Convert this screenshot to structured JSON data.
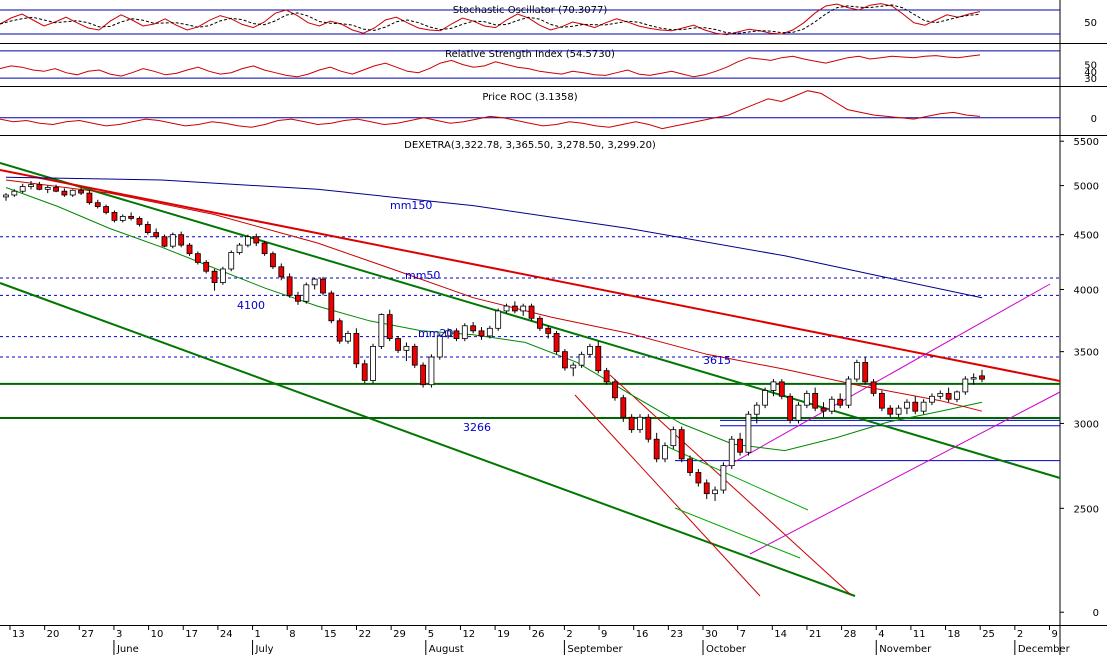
{
  "chart_data": {
    "type": "candlestick",
    "title": "DEXETRA(3,322.78, 3,365.50, 3,278.50, 3,299.20)",
    "price_axis": {
      "ticks": [
        5500,
        5000,
        4500,
        4000,
        3500,
        3000,
        2500,
        2000
      ],
      "tick_labels": [
        "5500",
        "5000",
        "4500",
        "4000",
        "3500",
        "3000",
        "2500",
        "0"
      ],
      "scale": "log",
      "range": [
        1950,
        5550
      ]
    },
    "x_axis": {
      "day_labels": [
        "13",
        "20",
        "27",
        "3",
        "10",
        "17",
        "24",
        "1",
        "8",
        "15",
        "22",
        "29",
        "5",
        "12",
        "19",
        "26",
        "2",
        "9",
        "16",
        "23",
        "30",
        "7",
        "14",
        "21",
        "28",
        "4",
        "11",
        "18",
        "25",
        "2",
        "9"
      ],
      "month_labels": [
        "June",
        "July",
        "August",
        "September",
        "October",
        "November",
        "December"
      ]
    },
    "annotations": [
      {
        "text": "mm150",
        "color": "#0000aa"
      },
      {
        "text": "mm50",
        "color": "#0000aa"
      },
      {
        "text": "mm20",
        "color": "#0000aa"
      },
      {
        "text": "4100",
        "color": "#0000aa"
      },
      {
        "text": "3615",
        "color": "#0000aa"
      },
      {
        "text": "3266",
        "color": "#0000aa"
      }
    ],
    "horizontal_levels": [
      {
        "value": 4480,
        "style": "dashed",
        "color": "#0000cc"
      },
      {
        "value": 4100,
        "style": "dashed",
        "color": "#0000cc"
      },
      {
        "value": 3950,
        "style": "dashed",
        "color": "#0000cc"
      },
      {
        "value": 3615,
        "style": "dashed",
        "color": "#0000cc"
      },
      {
        "value": 3460,
        "style": "dashed",
        "color": "#0000cc"
      },
      {
        "value": 3266,
        "style": "solid",
        "color": "#006600"
      },
      {
        "value": 3020,
        "style": "solid",
        "color": "#0000cc"
      },
      {
        "value": 2985,
        "style": "solid",
        "color": "#0000cc"
      },
      {
        "value": 2770,
        "style": "solid",
        "color": "#0000cc"
      }
    ],
    "candles": [
      [
        4880,
        4920,
        4840,
        4900
      ],
      [
        4900,
        4960,
        4880,
        4940
      ],
      [
        4940,
        5020,
        4920,
        4990
      ],
      [
        4990,
        5050,
        4960,
        5010
      ],
      [
        5010,
        5040,
        4950,
        4960
      ],
      [
        4960,
        5000,
        4920,
        4980
      ],
      [
        4980,
        5010,
        4930,
        4940
      ],
      [
        4940,
        4970,
        4880,
        4900
      ],
      [
        4900,
        4960,
        4880,
        4950
      ],
      [
        4950,
        4980,
        4900,
        4920
      ],
      [
        4920,
        4950,
        4800,
        4820
      ],
      [
        4820,
        4850,
        4760,
        4780
      ],
      [
        4780,
        4800,
        4700,
        4720
      ],
      [
        4720,
        4740,
        4620,
        4640
      ],
      [
        4640,
        4700,
        4620,
        4680
      ],
      [
        4680,
        4720,
        4640,
        4660
      ],
      [
        4660,
        4680,
        4580,
        4600
      ],
      [
        4600,
        4630,
        4500,
        4520
      ],
      [
        4520,
        4560,
        4460,
        4480
      ],
      [
        4480,
        4500,
        4380,
        4390
      ],
      [
        4390,
        4520,
        4370,
        4500
      ],
      [
        4500,
        4530,
        4380,
        4400
      ],
      [
        4400,
        4420,
        4300,
        4320
      ],
      [
        4320,
        4340,
        4220,
        4240
      ],
      [
        4240,
        4260,
        4140,
        4160
      ],
      [
        4160,
        4180,
        3990,
        4060
      ],
      [
        4060,
        4200,
        4040,
        4180
      ],
      [
        4180,
        4350,
        4160,
        4330
      ],
      [
        4330,
        4420,
        4310,
        4400
      ],
      [
        4400,
        4500,
        4380,
        4480
      ],
      [
        4480,
        4510,
        4390,
        4420
      ],
      [
        4420,
        4440,
        4300,
        4320
      ],
      [
        4320,
        4340,
        4180,
        4200
      ],
      [
        4200,
        4230,
        4080,
        4110
      ],
      [
        4110,
        4140,
        3930,
        3950
      ],
      [
        3950,
        3980,
        3870,
        3900
      ],
      [
        3900,
        4060,
        3880,
        4040
      ],
      [
        4040,
        4100,
        4000,
        4090
      ],
      [
        4090,
        4110,
        3950,
        3970
      ],
      [
        3970,
        3990,
        3720,
        3740
      ],
      [
        3740,
        3760,
        3560,
        3580
      ],
      [
        3580,
        3660,
        3560,
        3640
      ],
      [
        3640,
        3680,
        3380,
        3410
      ],
      [
        3410,
        3440,
        3270,
        3290
      ],
      [
        3290,
        3560,
        3270,
        3540
      ],
      [
        3540,
        3800,
        3520,
        3790
      ],
      [
        3790,
        3830,
        3580,
        3600
      ],
      [
        3600,
        3620,
        3490,
        3510
      ],
      [
        3510,
        3570,
        3430,
        3540
      ],
      [
        3540,
        3560,
        3380,
        3400
      ],
      [
        3400,
        3420,
        3240,
        3260
      ],
      [
        3260,
        3480,
        3240,
        3460
      ],
      [
        3460,
        3640,
        3440,
        3620
      ],
      [
        3620,
        3680,
        3600,
        3660
      ],
      [
        3660,
        3680,
        3580,
        3600
      ],
      [
        3600,
        3720,
        3580,
        3700
      ],
      [
        3700,
        3730,
        3640,
        3660
      ],
      [
        3660,
        3690,
        3590,
        3620
      ],
      [
        3620,
        3700,
        3600,
        3680
      ],
      [
        3680,
        3840,
        3660,
        3820
      ],
      [
        3820,
        3880,
        3800,
        3860
      ],
      [
        3860,
        3900,
        3800,
        3820
      ],
      [
        3820,
        3880,
        3780,
        3860
      ],
      [
        3860,
        3880,
        3740,
        3760
      ],
      [
        3760,
        3780,
        3660,
        3680
      ],
      [
        3680,
        3700,
        3600,
        3640
      ],
      [
        3640,
        3660,
        3480,
        3500
      ],
      [
        3500,
        3520,
        3360,
        3380
      ],
      [
        3380,
        3420,
        3320,
        3400
      ],
      [
        3400,
        3500,
        3380,
        3480
      ],
      [
        3480,
        3560,
        3460,
        3540
      ],
      [
        3540,
        3580,
        3340,
        3360
      ],
      [
        3360,
        3380,
        3260,
        3280
      ],
      [
        3280,
        3300,
        3150,
        3170
      ],
      [
        3170,
        3190,
        3010,
        3040
      ],
      [
        3040,
        3060,
        2940,
        2960
      ],
      [
        2960,
        3060,
        2940,
        3040
      ],
      [
        3040,
        3060,
        2880,
        2900
      ],
      [
        2900,
        2940,
        2760,
        2780
      ],
      [
        2780,
        2880,
        2760,
        2860
      ],
      [
        2860,
        2980,
        2840,
        2960
      ],
      [
        2960,
        2980,
        2760,
        2780
      ],
      [
        2780,
        2800,
        2680,
        2700
      ],
      [
        2700,
        2720,
        2620,
        2640
      ],
      [
        2640,
        2660,
        2550,
        2580
      ],
      [
        2580,
        2620,
        2540,
        2600
      ],
      [
        2600,
        2760,
        2580,
        2740
      ],
      [
        2740,
        2920,
        2720,
        2900
      ],
      [
        2900,
        2940,
        2800,
        2820
      ],
      [
        2820,
        3080,
        2800,
        3060
      ],
      [
        3060,
        3140,
        3000,
        3120
      ],
      [
        3120,
        3240,
        3100,
        3220
      ],
      [
        3220,
        3300,
        3180,
        3280
      ],
      [
        3280,
        3300,
        3160,
        3180
      ],
      [
        3180,
        3200,
        3000,
        3020
      ],
      [
        3020,
        3140,
        3000,
        3120
      ],
      [
        3120,
        3220,
        3100,
        3200
      ],
      [
        3200,
        3240,
        3080,
        3100
      ],
      [
        3100,
        3140,
        3040,
        3080
      ],
      [
        3080,
        3180,
        3060,
        3160
      ],
      [
        3160,
        3200,
        3100,
        3120
      ],
      [
        3120,
        3320,
        3100,
        3300
      ],
      [
        3300,
        3440,
        3280,
        3420
      ],
      [
        3420,
        3460,
        3260,
        3280
      ],
      [
        3280,
        3300,
        3180,
        3200
      ],
      [
        3200,
        3220,
        3080,
        3100
      ],
      [
        3100,
        3120,
        3040,
        3060
      ],
      [
        3060,
        3120,
        3040,
        3100
      ],
      [
        3100,
        3160,
        3060,
        3140
      ],
      [
        3140,
        3180,
        3060,
        3080
      ],
      [
        3080,
        3160,
        3060,
        3140
      ],
      [
        3140,
        3200,
        3120,
        3180
      ],
      [
        3180,
        3220,
        3160,
        3200
      ],
      [
        3200,
        3240,
        3140,
        3160
      ],
      [
        3160,
        3220,
        3140,
        3210
      ],
      [
        3210,
        3320,
        3190,
        3300
      ],
      [
        3300,
        3340,
        3260,
        3310
      ],
      [
        3322.78,
        3365.5,
        3278.5,
        3299.2
      ]
    ],
    "moving_averages": [
      {
        "name": "mm20",
        "color": "#008800",
        "values": [
          [
            0,
            4980
          ],
          [
            20,
            4780
          ],
          [
            40,
            4560
          ],
          [
            60,
            4380
          ],
          [
            80,
            4190
          ],
          [
            100,
            4010
          ],
          [
            120,
            3860
          ],
          [
            140,
            3740
          ],
          [
            160,
            3660
          ],
          [
            180,
            3630
          ],
          [
            200,
            3570
          ],
          [
            220,
            3420
          ],
          [
            240,
            3200
          ],
          [
            260,
            3000
          ],
          [
            280,
            2870
          ],
          [
            300,
            2830
          ],
          [
            320,
            2910
          ],
          [
            340,
            3010
          ],
          [
            360,
            3080
          ],
          [
            376,
            3140
          ]
        ]
      },
      {
        "name": "mm50",
        "color": "#cc0000",
        "values": [
          [
            0,
            5060
          ],
          [
            40,
            4920
          ],
          [
            80,
            4700
          ],
          [
            120,
            4420
          ],
          [
            150,
            4170
          ],
          [
            180,
            3930
          ],
          [
            210,
            3770
          ],
          [
            240,
            3640
          ],
          [
            270,
            3480
          ],
          [
            300,
            3370
          ],
          [
            330,
            3250
          ],
          [
            360,
            3150
          ],
          [
            376,
            3080
          ]
        ]
      },
      {
        "name": "mm150",
        "color": "#000088",
        "values": [
          [
            0,
            5090
          ],
          [
            60,
            5060
          ],
          [
            120,
            4960
          ],
          [
            180,
            4790
          ],
          [
            240,
            4560
          ],
          [
            300,
            4300
          ],
          [
            340,
            4100
          ],
          [
            376,
            3930
          ]
        ]
      }
    ],
    "trend_lines": [
      {
        "name": "upper-channel-green",
        "color": "#007700"
      },
      {
        "name": "lower-channel-green",
        "color": "#007700"
      },
      {
        "name": "resistance-red",
        "color": "#dd0000"
      },
      {
        "name": "support-3266-green",
        "color": "#006600"
      },
      {
        "name": "fan-red-thin",
        "color": "#cc0000"
      },
      {
        "name": "fan-red-thin-2",
        "color": "#cc0000"
      },
      {
        "name": "channel-magenta-upper",
        "color": "#cc00cc"
      },
      {
        "name": "channel-magenta-lower",
        "color": "#cc00cc"
      },
      {
        "name": "channel-green-small-upper",
        "color": "#00aa00"
      },
      {
        "name": "channel-green-small-lower",
        "color": "#00aa00"
      }
    ],
    "indicators": [
      {
        "name": "Stochastic Oscillator",
        "title": "Stochastic Oscillator (70.3077)",
        "ticks": [
          "50"
        ],
        "range": [
          0,
          100
        ],
        "levels": [
          80,
          20
        ],
        "values": [
          45,
          60,
          70,
          55,
          40,
          50,
          62,
          48,
          35,
          30,
          52,
          68,
          55,
          40,
          45,
          58,
          42,
          30,
          38,
          54,
          66,
          58,
          44,
          36,
          50,
          72,
          80,
          66,
          48,
          40,
          52,
          45,
          30,
          22,
          35,
          55,
          62,
          48,
          35,
          30,
          28,
          45,
          60,
          52,
          40,
          36,
          55,
          70,
          60,
          42,
          30,
          38,
          50,
          44,
          36,
          48,
          58,
          50,
          40,
          34,
          30,
          28,
          35,
          42,
          30,
          22,
          18,
          25,
          32,
          28,
          22,
          20,
          30,
          48,
          72,
          90,
          95,
          86,
          80,
          92,
          96,
          90,
          70,
          48,
          42,
          55,
          68,
          62,
          70,
          76
        ]
      },
      {
        "name": "Relative Strength Index",
        "title": "Relative Strength Index (54.5730)",
        "ticks": [
          "50",
          "40",
          "30"
        ],
        "range": [
          20,
          80
        ],
        "levels": [
          70,
          30
        ],
        "values": [
          44,
          48,
          46,
          42,
          40,
          44,
          38,
          35,
          40,
          42,
          36,
          33,
          38,
          44,
          40,
          35,
          37,
          42,
          46,
          40,
          36,
          38,
          44,
          48,
          42,
          38,
          34,
          32,
          36,
          42,
          46,
          40,
          36,
          42,
          48,
          52,
          46,
          40,
          38,
          44,
          52,
          56,
          50,
          46,
          48,
          54,
          50,
          46,
          44,
          40,
          38,
          36,
          40,
          38,
          35,
          34,
          38,
          42,
          36,
          34,
          37,
          40,
          36,
          32,
          35,
          40,
          46,
          54,
          60,
          58,
          56,
          60,
          62,
          58,
          55,
          52,
          56,
          60,
          62,
          58,
          60,
          62,
          61,
          60,
          62,
          63,
          61,
          60,
          62,
          64
        ]
      },
      {
        "name": "Price ROC",
        "title": "Price ROC (3.1358)",
        "ticks": [
          "0"
        ],
        "range": [
          -12,
          22
        ],
        "levels": [
          0
        ],
        "values": [
          -1,
          -3,
          -2,
          -4,
          -5,
          -3,
          -2,
          -4,
          -6,
          -5,
          -3,
          -1,
          -2,
          -4,
          -6,
          -5,
          -3,
          -4,
          -6,
          -7,
          -5,
          -2,
          -1,
          -3,
          -5,
          -4,
          -2,
          -1,
          -3,
          -5,
          -4,
          -2,
          0,
          -2,
          -4,
          -3,
          -1,
          1,
          0,
          -2,
          -4,
          -6,
          -5,
          -3,
          -4,
          -6,
          -7,
          -5,
          -3,
          -5,
          -8,
          -6,
          -4,
          -2,
          0,
          2,
          6,
          10,
          14,
          12,
          16,
          20,
          18,
          12,
          6,
          4,
          2,
          1,
          0,
          -1,
          1,
          3,
          4,
          2,
          1
        ]
      }
    ]
  }
}
